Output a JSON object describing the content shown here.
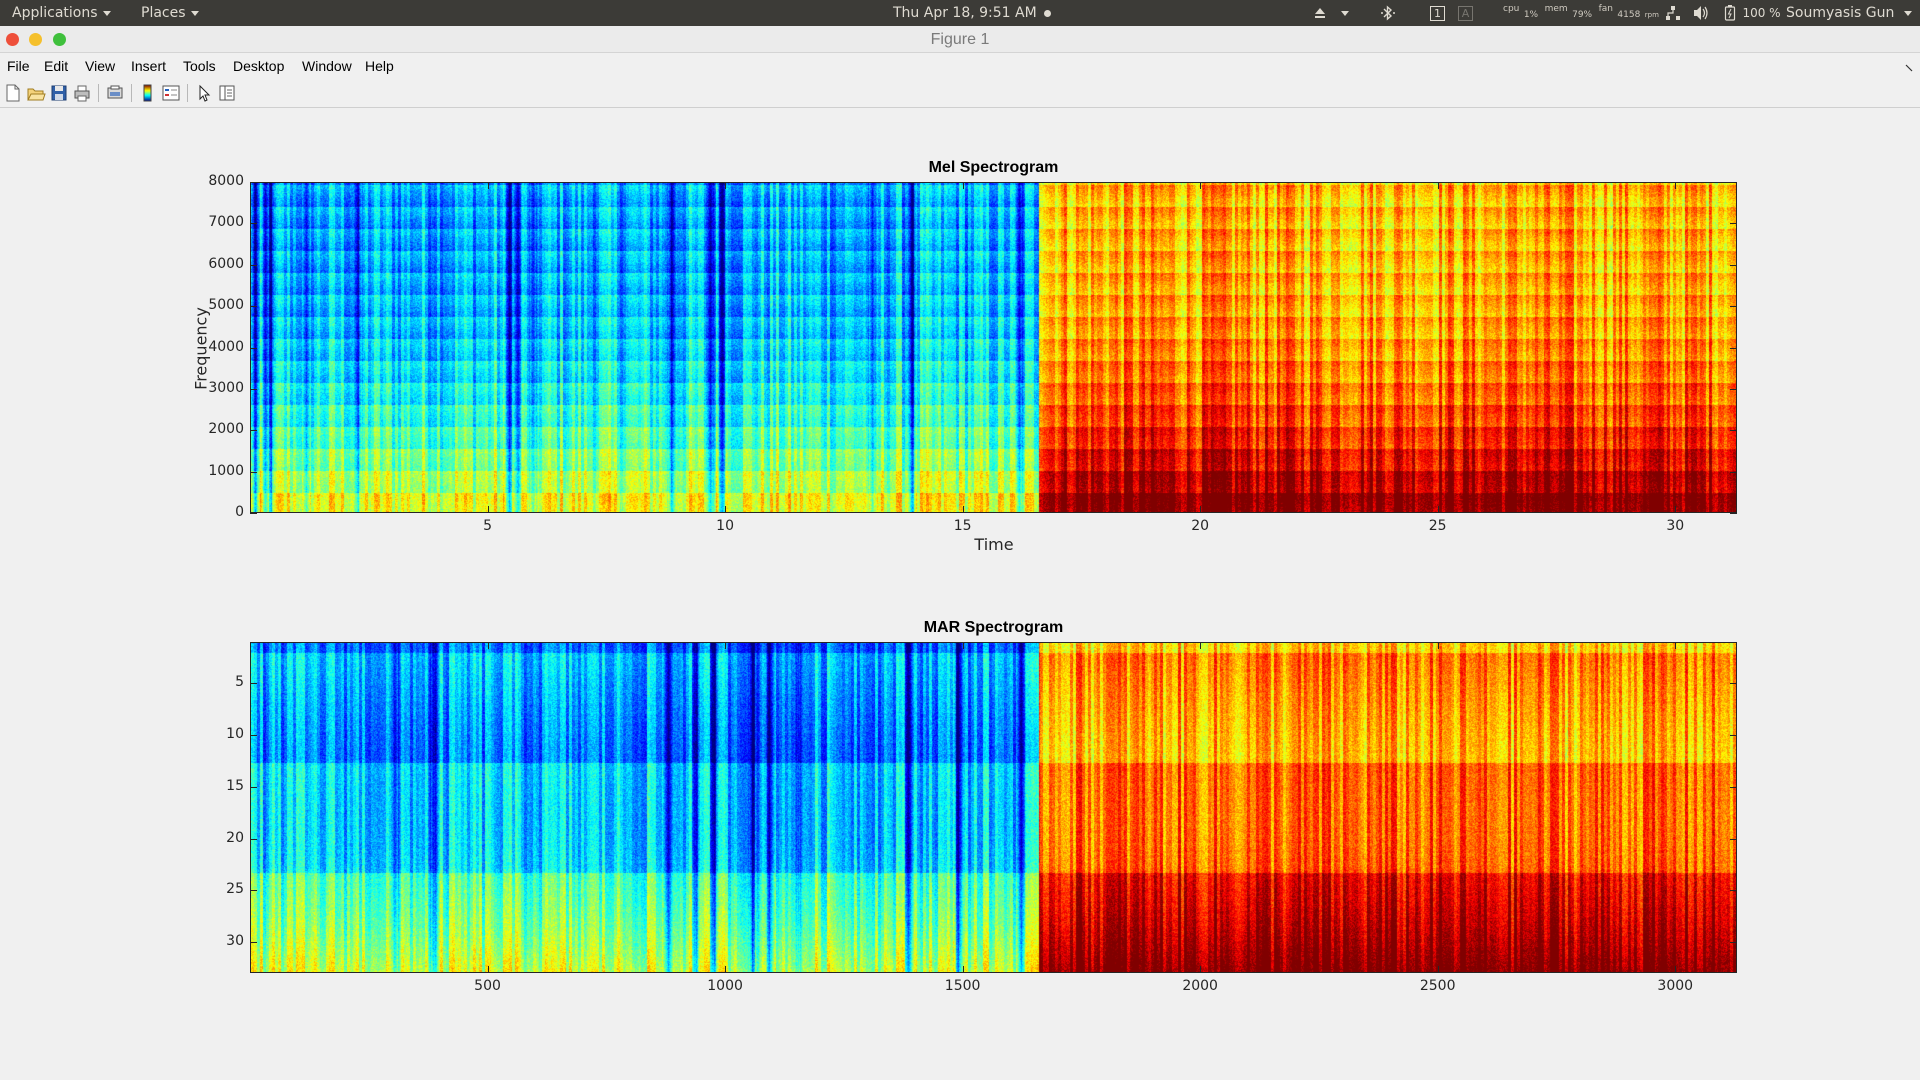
{
  "system_panel": {
    "applications": "Applications",
    "places": "Places",
    "clock": "Thu Apr 18,  9:51 AM",
    "cpu_label": "cpu",
    "cpu_value": "1%",
    "mem_label": "mem",
    "mem_value": "79%",
    "fan_label": "fan",
    "fan_value": "4158",
    "fan_unit": "rpm",
    "workspace_1": "1",
    "workspace_2": "A",
    "battery": "100 %",
    "user": "Soumyasis Gun"
  },
  "window": {
    "title": "Figure 1"
  },
  "menu": [
    "File",
    "Edit",
    "View",
    "Insert",
    "Tools",
    "Desktop",
    "Window",
    "Help"
  ],
  "toolbar_icons": [
    "new-figure-icon",
    "open-file-icon",
    "save-icon",
    "print-icon",
    "print-preview-icon",
    "colorbar-icon",
    "legend-icon",
    "pointer-icon",
    "property-editor-icon"
  ],
  "colors": {
    "colormap": "jet",
    "panel_bg": "#3c3b37",
    "close": "#ee4f3a",
    "minimize": "#f5c02c",
    "maximize": "#3fc03c"
  },
  "chart_data": [
    {
      "type": "heatmap",
      "title": "Mel Spectrogram",
      "xlabel": "Time",
      "ylabel": "Frequency",
      "xlim": [
        0,
        31.3
      ],
      "ylim": [
        0,
        8000
      ],
      "xticks": [
        5,
        10,
        15,
        20,
        25,
        30
      ],
      "yticks": [
        0,
        1000,
        2000,
        3000,
        4000,
        5000,
        6000,
        7000,
        8000
      ],
      "colormap": "jet",
      "segments": [
        {
          "x_range": [
            0,
            16.6
          ],
          "description_level": "low",
          "mean_intensity": 0.3
        },
        {
          "x_range": [
            16.6,
            31.3
          ],
          "description_level": "high",
          "mean_intensity": 0.7
        }
      ]
    },
    {
      "type": "heatmap",
      "title": "MAR Spectrogram",
      "xlabel": "",
      "ylabel": "",
      "xlim": [
        0,
        3130
      ],
      "ylim": [
        33,
        1
      ],
      "xticks": [
        500,
        1000,
        1500,
        2000,
        2500,
        3000
      ],
      "yticks": [
        5,
        10,
        15,
        20,
        25,
        30
      ],
      "colormap": "jet",
      "segments": [
        {
          "x_range": [
            0,
            1660
          ],
          "mean_intensity": 0.28
        },
        {
          "x_range": [
            1660,
            3130
          ],
          "mean_intensity": 0.72
        }
      ]
    }
  ]
}
